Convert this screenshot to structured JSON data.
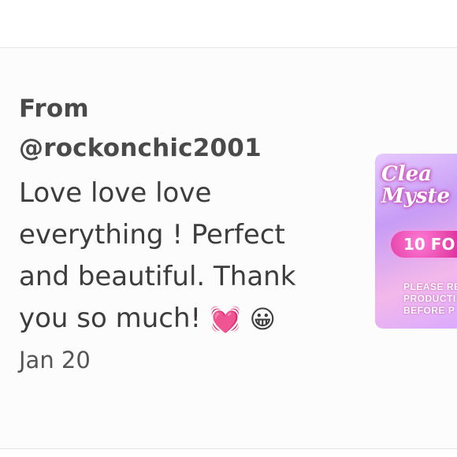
{
  "review": {
    "from_label": "From",
    "handle": "@rockonchic2001",
    "comment": "Love love love everything ! Perfect and beautiful. Thank you so much!",
    "emojis": [
      "💓",
      "😀"
    ],
    "date": "Jan 20"
  },
  "product_thumbnail": {
    "title_line1": "Clea",
    "title_line2": "Myste",
    "pill_text": "10 FO",
    "notice": "PLEASE REA\nPRODUCTI\nBEFORE P"
  }
}
